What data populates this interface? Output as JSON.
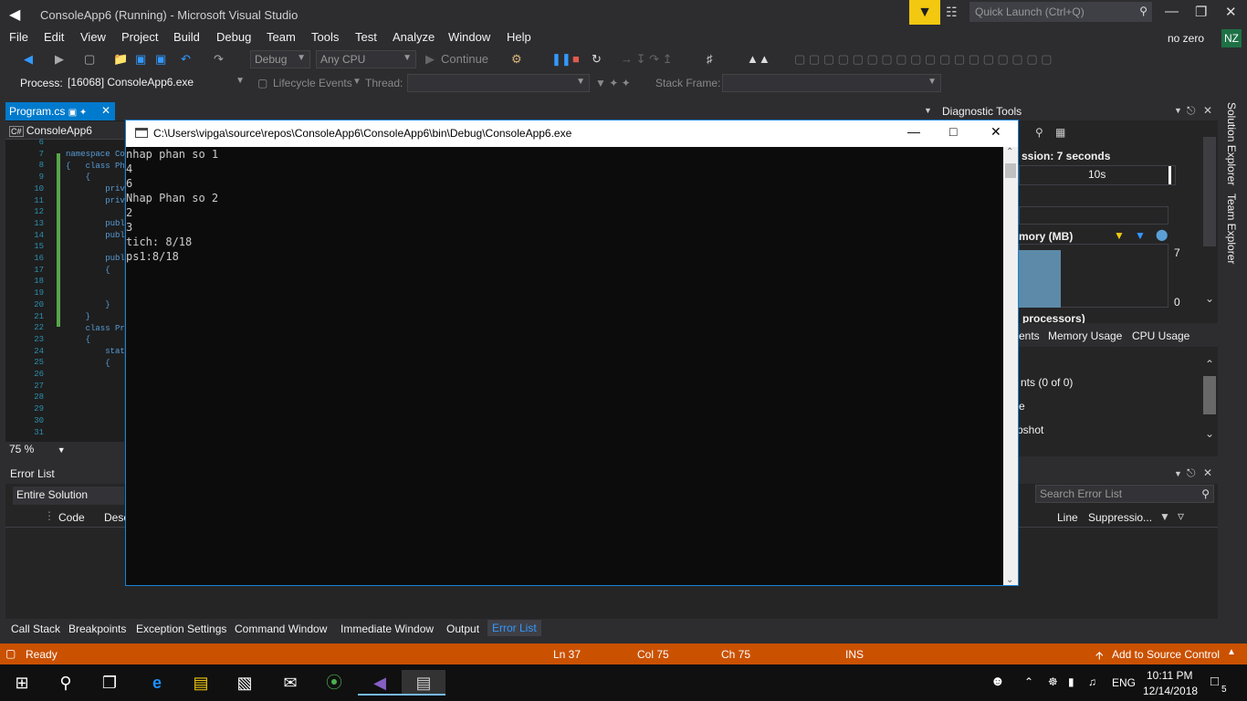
{
  "window": {
    "title": "ConsoleApp6 (Running) - Microsoft Visual Studio",
    "quick_launch_placeholder": "Quick Launch (Ctrl+Q)",
    "user": "no zero",
    "avatar": "NZ"
  },
  "menu": [
    "File",
    "Edit",
    "View",
    "Project",
    "Build",
    "Debug",
    "Team",
    "Tools",
    "Test",
    "Analyze",
    "Window",
    "Help"
  ],
  "toolbar": {
    "config": "Debug",
    "platform": "Any CPU",
    "continue_label": "Continue"
  },
  "debugbar": {
    "process_label": "Process:",
    "process_value": "[16068] ConsoleApp6.exe",
    "lifecycle": "Lifecycle Events",
    "thread_label": "Thread:",
    "stack_frame_label": "Stack Frame:"
  },
  "editor": {
    "tab": "Program.cs",
    "project": "ConsoleApp6",
    "zoom": "75 %",
    "line_numbers": [
      "6",
      "7",
      "8",
      "9",
      "10",
      "11",
      "12",
      "13",
      "14",
      "15",
      "16",
      "17",
      "18",
      "19",
      "20",
      "21",
      "22",
      "23",
      "24",
      "25",
      "26",
      "27",
      "28",
      "29",
      "30",
      "31"
    ],
    "code_lines": [
      "namespace Co",
      "{   class Ph",
      "    {",
      "        priv",
      "        priv",
      "",
      "        publ",
      "        publ",
      "",
      "        publ",
      "        {",
      "",
      "",
      "        }",
      "    }",
      "    class Pr",
      "    {",
      "        stat",
      "        {",
      "",
      "",
      "",
      "",
      "",
      ""
    ]
  },
  "diagnostic": {
    "title": "Diagnostic Tools",
    "session": "ssion: 7 seconds",
    "time_tick": "10s",
    "memory": "mory (MB)",
    "mem_max": "7",
    "mem_min": "0",
    "processors": "processors)",
    "tabs": [
      "ents",
      "Memory Usage",
      "CPU Usage"
    ],
    "events": "nts (0 of 0)",
    "row2": "e",
    "snapshot": "pshot"
  },
  "error_list": {
    "title": "Error List",
    "scope": "Entire Solution",
    "search_placeholder": "Search Error List",
    "columns": [
      "Code",
      "Desc",
      "Line",
      "Suppressio..."
    ]
  },
  "bottom_tabs": [
    "Call Stack",
    "Breakpoints",
    "Exception Settings",
    "Command Window",
    "Immediate Window",
    "Output",
    "Error List"
  ],
  "status": {
    "state": "Ready",
    "ln": "Ln 37",
    "col": "Col 75",
    "ch": "Ch 75",
    "ins": "INS",
    "source_control": "Add to Source Control"
  },
  "side_tabs": [
    "Solution Explorer",
    "Team Explorer"
  ],
  "console": {
    "title": "C:\\Users\\vipga\\source\\repos\\ConsoleApp6\\ConsoleApp6\\bin\\Debug\\ConsoleApp6.exe",
    "lines": [
      "nhap phan so 1",
      "4",
      "6",
      "Nhap Phan so 2",
      "2",
      "3",
      "tich: 8/18",
      "ps1:8/18"
    ]
  },
  "taskbar": {
    "lang": "ENG",
    "time": "10:11 PM",
    "date": "12/14/2018",
    "notifications": "5"
  }
}
